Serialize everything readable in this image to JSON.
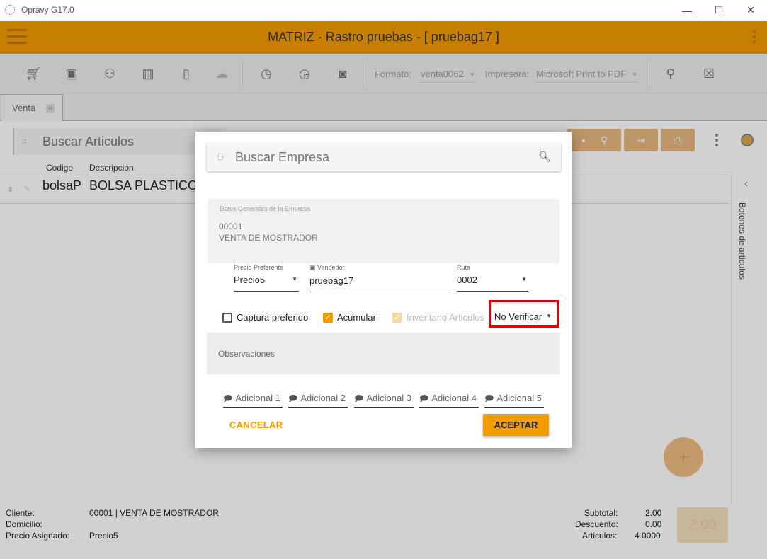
{
  "window": {
    "title": "Opravy G17.0",
    "minimize": "—",
    "maximize": "☐",
    "close": "✕"
  },
  "header": {
    "title": "MATRIZ - Rastro pruebas - [ pruebag17 ]"
  },
  "toolbar": {
    "icons": [
      "cart-icon",
      "cash-icon",
      "people-icon",
      "barcode-icon",
      "tablet-icon",
      "cloud-icon",
      "clock-icon",
      "clock-refresh-icon",
      "money-icon",
      "add-person-icon",
      "close-box-icon"
    ],
    "formato_label": "Formato:",
    "formato_value": "venta0062",
    "impresora_label": "Impresora:",
    "impresora_value": "Microsoft Print to PDF"
  },
  "tabs": [
    {
      "label": "Venta"
    }
  ],
  "main": {
    "search_placeholder": "Buscar Articulos",
    "columns": [
      "Codigo",
      "Descripcion"
    ],
    "rows": [
      {
        "code": "bolsaP",
        "description": "BOLSA PLASTICO C"
      }
    ],
    "side_panel_label": "Botones de articulos"
  },
  "footer": {
    "cliente_label": "Cliente:",
    "cliente_value": "00001 | VENTA DE MOSTRADOR",
    "domicilio_label": "Domicilio:",
    "precio_label": "Precio Asignado:",
    "precio_value": "Precio5",
    "subtotal_label": "Subtotal:",
    "subtotal_value": "2.00",
    "descuento_label": "Descuento:",
    "descuento_value": "0.00",
    "articulos_label": "Articulos:",
    "articulos_value": "4.0000",
    "total": "2.00"
  },
  "dialog": {
    "search_placeholder": "Buscar Empresa",
    "company_caption": "Datos Generales de la Empresa",
    "company_code": "00001",
    "company_name": "VENTA DE MOSTRADOR",
    "precio_caption": "Precio Preferente",
    "precio_value": "Precio5",
    "vendedor_caption": "Vendedor",
    "vendedor_value": "pruebag17",
    "ruta_caption": "Ruta",
    "ruta_value": "0002",
    "captura_label": "Captura preferido",
    "captura_checked": false,
    "acumular_label": "Acumular",
    "acumular_checked": true,
    "inventario_label": "Inventario Articulos",
    "inventario_checked": true,
    "verificar_value": "No Verificar",
    "observaciones_placeholder": "Observaciones",
    "adicionales": [
      "Adicional 1",
      "Adicional 2",
      "Adicional 3",
      "Adicional 4",
      "Adicional 5"
    ],
    "cancel_label": "CANCELAR",
    "ok_label": "ACEPTAR"
  },
  "colors": {
    "accent": "#f29c00",
    "highlight": "#e00000"
  }
}
